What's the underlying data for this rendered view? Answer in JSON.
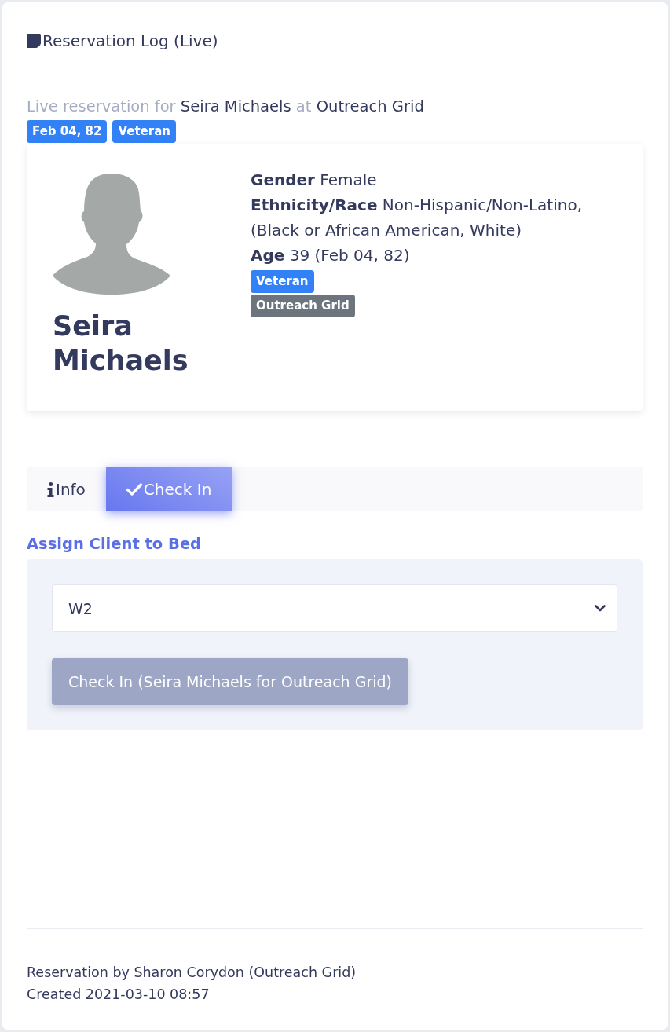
{
  "header": {
    "title": "Reservation Log (Live)"
  },
  "summary": {
    "prefix": "Live reservation for",
    "client": "Seira Michaels",
    "joiner": "at",
    "program": "Outreach Grid"
  },
  "summary_tags": [
    {
      "text": "Feb 04, 82"
    },
    {
      "text": "Veteran"
    }
  ],
  "profile": {
    "name": "Seira Michaels",
    "fields": [
      {
        "label": "Gender",
        "value": "Female"
      },
      {
        "label": "Ethnicity/Race",
        "value": "Non-Hispanic/Non-Latino, (Black or African American, White)"
      },
      {
        "label": "Age",
        "value": "39 (Feb 04, 82)"
      }
    ],
    "tags": [
      {
        "text": "Veteran",
        "color": "#3381f6"
      },
      {
        "text": "Outreach Grid",
        "color": "#6c757d"
      }
    ]
  },
  "tabs": [
    {
      "label": "Info",
      "selected": false
    },
    {
      "label": "Check In",
      "selected": true
    }
  ],
  "check_in": {
    "heading": "Assign Client to Bed",
    "bed": {
      "value": "W2"
    },
    "button": {
      "label": "Check In (Seira Michaels for Outreach Grid)",
      "disabled": true
    }
  },
  "footer": {
    "lines": [
      "Reservation by Sharon Corydon (Outreach Grid)",
      "Created 2021-03-10 08:57"
    ]
  }
}
